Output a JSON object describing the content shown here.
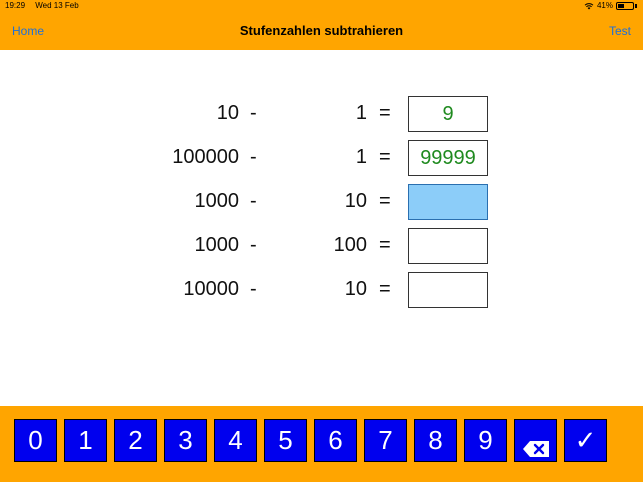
{
  "status_bar": {
    "time": "19:29",
    "date": "Wed 13 Feb",
    "battery_percent": "41%",
    "battery_level": 0.41,
    "icons": [
      "wifi-icon",
      "battery-icon"
    ]
  },
  "nav": {
    "home_label": "Home",
    "title": "Stufenzahlen subtrahieren",
    "test_label": "Test"
  },
  "equations": [
    {
      "a": "10",
      "op": "-",
      "b": "1",
      "eq": "=",
      "answer": "9",
      "state": "answered"
    },
    {
      "a": "100000",
      "op": "-",
      "b": "1",
      "eq": "=",
      "answer": "99999",
      "state": "answered"
    },
    {
      "a": "1000",
      "op": "-",
      "b": "10",
      "eq": "=",
      "answer": "",
      "state": "active"
    },
    {
      "a": "1000",
      "op": "-",
      "b": "100",
      "eq": "=",
      "answer": "",
      "state": "empty"
    },
    {
      "a": "10000",
      "op": "-",
      "b": "10",
      "eq": "=",
      "answer": "",
      "state": "empty"
    }
  ],
  "keypad": {
    "digits": [
      "0",
      "1",
      "2",
      "3",
      "4",
      "5",
      "6",
      "7",
      "8",
      "9"
    ],
    "backspace_icon": "backspace-icon",
    "confirm_label": "✓"
  },
  "colors": {
    "bar": "#ffa500",
    "key": "#0000ee",
    "answer_text": "#1f8a1f",
    "active_box": "#8ccdf9",
    "link": "#1e6fd9"
  }
}
